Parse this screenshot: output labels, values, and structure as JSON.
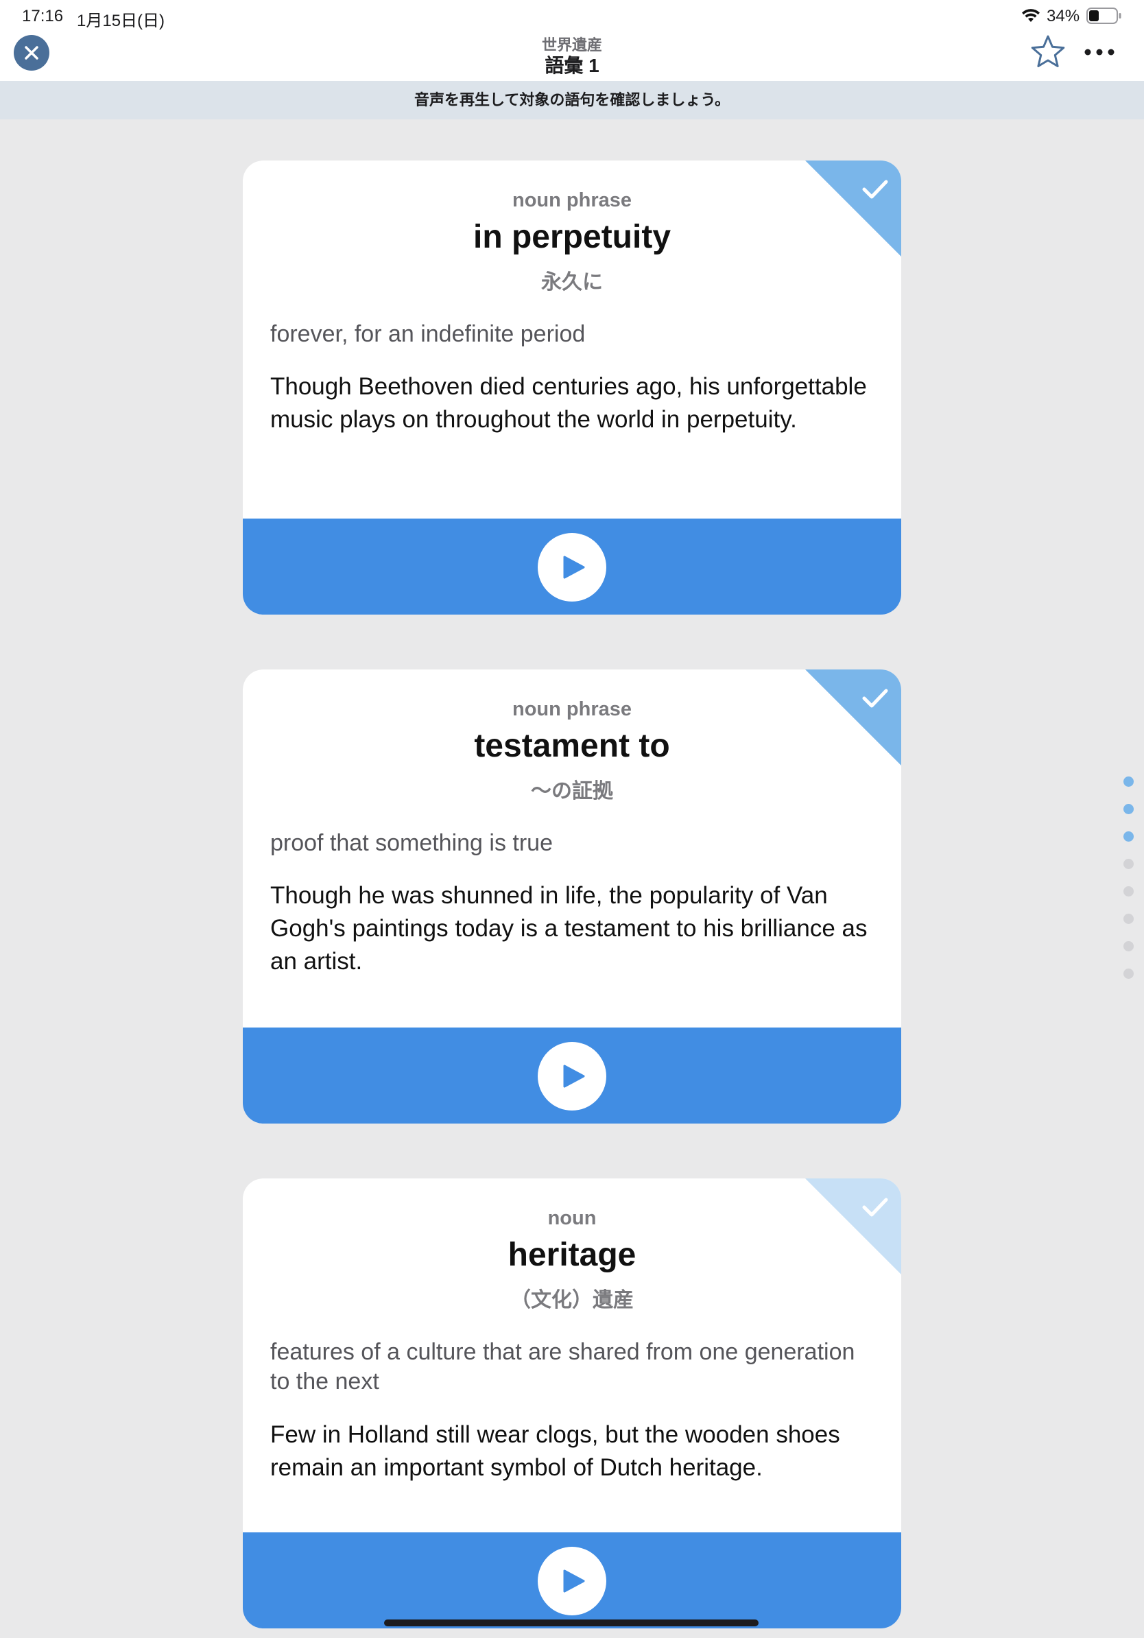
{
  "status_bar": {
    "time": "17:16",
    "date": "1月15日(日)",
    "battery": "34%"
  },
  "header": {
    "subtitle": "世界遺産",
    "title": "語彙 1",
    "close_icon": "close-icon",
    "star_icon": "star-outline-icon",
    "more_icon": "more-dots-icon"
  },
  "instruction": "音声を再生して対象の語句を確認しましょう。",
  "colors": {
    "accent_blue": "#418de3",
    "check_badge_done": "#7ab6ea",
    "check_badge_pending": "#c7e0f6",
    "close_button": "#4a6f99",
    "dot_active": "#7ab6ea",
    "dot_inactive": "#d3d3d6"
  },
  "cards": [
    {
      "pos": "noun phrase",
      "term": "in perpetuity",
      "translation": "永久に",
      "definition": "forever, for an indefinite period",
      "example": "Though Beethoven died centuries ago, his unforgettable music plays on throughout the world in perpetuity.",
      "checked": true
    },
    {
      "pos": "noun phrase",
      "term": "testament to",
      "translation": "〜の証拠",
      "definition": "proof that something is true",
      "example": "Though he was shunned in life, the popularity of Van Gogh's paintings today is a testament to his brilliance as an artist.",
      "checked": true
    },
    {
      "pos": "noun",
      "term": "heritage",
      "translation": "（文化）遺産",
      "definition": "features of a culture that are shared from one generation to the next",
      "example": "Few in Holland still wear clogs, but the wooden shoes remain an important symbol of Dutch heritage.",
      "checked": false
    }
  ],
  "pagination": {
    "total": 8,
    "active": [
      0,
      1,
      2
    ]
  }
}
